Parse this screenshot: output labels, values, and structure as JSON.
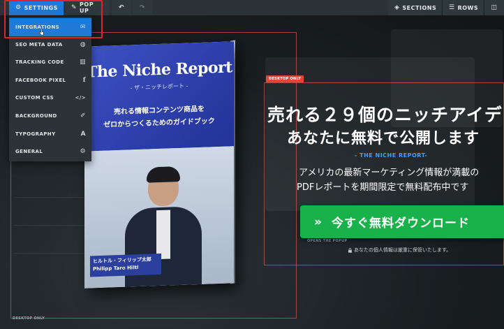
{
  "toolbar": {
    "settings_label": "SETTINGS",
    "popup_label": "POP UP",
    "sections_label": "SECTIONS",
    "rows_label": "ROWS"
  },
  "menu": {
    "items": [
      {
        "label": "INTEGRATIONS",
        "icon": "envelope-icon"
      },
      {
        "label": "SEO META DATA",
        "icon": "globe-icon"
      },
      {
        "label": "TRACKING CODE",
        "icon": "bar-chart-icon"
      },
      {
        "label": "FACEBOOK PIXEL",
        "icon": "facebook-icon"
      },
      {
        "label": "CUSTOM CSS",
        "icon": "code-icon"
      },
      {
        "label": "BACKGROUND",
        "icon": "brush-icon"
      },
      {
        "label": "TYPOGRAPHY",
        "icon": "font-icon"
      },
      {
        "label": "GENERAL",
        "icon": "gear-icon"
      }
    ]
  },
  "tags": {
    "desktop_only_top": "DESKTOP ONLY",
    "desktop_only_bottom": "DESKTOP ONLY",
    "opens_popup": "OPENS THE POPUP"
  },
  "book": {
    "title": "The Niche Report",
    "subtitle": "- ザ・ニッチレポート -",
    "tagline1": "売れる情報コンテンツ商品を",
    "tagline2": "ゼロからつくるためのガイドブック",
    "author_ja": "ヒルトル・フィリップ太郎",
    "author_en": "Philipp Taro Hiltl"
  },
  "content": {
    "headline1": "売れる２９個のニッチアイデ",
    "headline2": "あなたに無料で公開します",
    "brand": "- THE NICHE REPORT-",
    "desc1": "アメリカの最新マーケティング情報が満載の",
    "desc2": "PDFレポートを期間限定で無料配布中です",
    "cta_chevron": "»",
    "cta_label": "今すぐ無料ダウンロード",
    "privacy": "あなたの個人情報は厳重に保管いたします。"
  },
  "colors": {
    "accent": "#1f79d6",
    "cta": "#19b24a",
    "tag": "#ea4336",
    "highlight": "#e0232a"
  }
}
